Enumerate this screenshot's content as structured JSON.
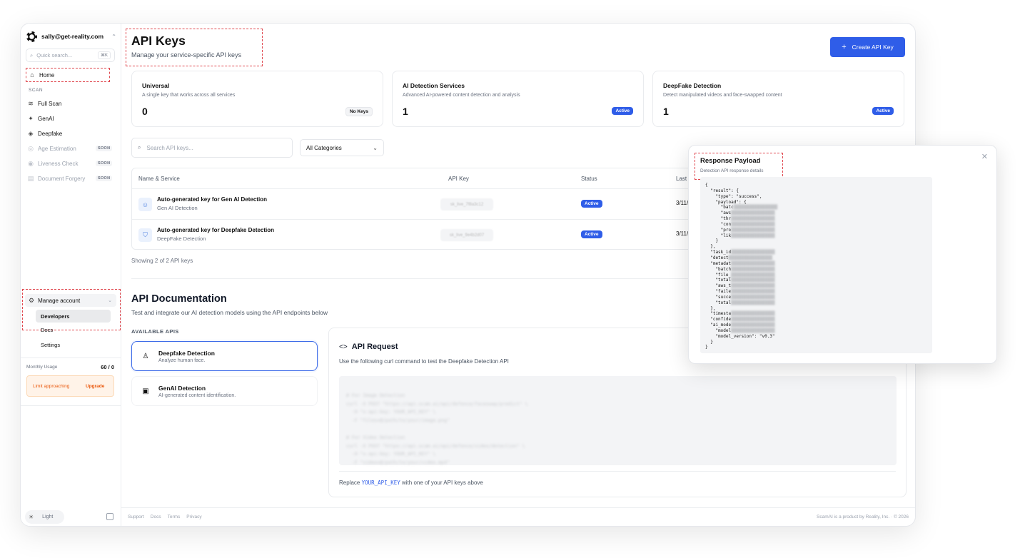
{
  "sidebar": {
    "account_email": "sally@get-reality.com",
    "search_placeholder": "Quick search...",
    "search_shortcut": "⌘K",
    "home_label": "Home",
    "section_scan": "SCAN",
    "items": [
      {
        "label": "Full Scan",
        "icon": "layers-icon"
      },
      {
        "label": "GenAI",
        "icon": "sparkles-icon"
      },
      {
        "label": "Deepfake",
        "icon": "tag-icon"
      },
      {
        "label": "Age Estimation",
        "icon": "user-circle-icon",
        "badge": "SOON"
      },
      {
        "label": "Liveness Check",
        "icon": "eye-icon",
        "badge": "SOON"
      },
      {
        "label": "Document Forgery",
        "icon": "document-icon",
        "badge": "SOON"
      }
    ],
    "manage_account": "Manage account",
    "sub_items": [
      "Developers",
      "Docs",
      "Settings"
    ],
    "usage_label": "Monthly Usage",
    "usage_value": "60 / 0",
    "limit_text": "Limit approaching",
    "upgrade_label": "Upgrade",
    "theme_label": "Light"
  },
  "header": {
    "title": "API Keys",
    "subtitle": "Manage your service-specific API keys",
    "create_button": "Create API Key"
  },
  "cards": [
    {
      "title": "Universal",
      "subtitle": "A single key that works across all services",
      "count": "0",
      "badge": "No Keys"
    },
    {
      "title": "AI Detection Services",
      "subtitle": "Advanced AI-powered content detection and analysis",
      "count": "1",
      "badge": "Active"
    },
    {
      "title": "DeepFake Detection",
      "subtitle": "Detect manipulated videos and face-swapped content",
      "count": "1",
      "badge": "Active"
    }
  ],
  "filters": {
    "search_placeholder": "Search API keys...",
    "category": "All Categories"
  },
  "table": {
    "headers": [
      "Name & Service",
      "API Key",
      "Status",
      "Last"
    ],
    "rows": [
      {
        "name": "Auto-generated key for Gen AI Detection",
        "service": "Gen AI Detection",
        "key": "sk_live_7f8a3c12",
        "status": "Active",
        "date": "3/11/2"
      },
      {
        "name": "Auto-generated key for Deepfake Detection",
        "service": "DeepFake Detection",
        "key": "sk_live_9e4b2d07",
        "status": "Active",
        "date": "3/11/2"
      }
    ],
    "showing": "Showing 2 of 2 API keys"
  },
  "docs": {
    "title": "API Documentation",
    "subtitle": "Test and integrate our AI detection models using the API endpoints below",
    "available_label": "AVAILABLE APIS",
    "apis": [
      {
        "title": "Deepfake Detection",
        "subtitle": "Analyze human face."
      },
      {
        "title": "GenAI Detection",
        "subtitle": "AI-generated content identification."
      }
    ],
    "request_title": "API Request",
    "request_desc": "Use the following curl command to test the Deepfake Detection API",
    "code_lines": [
      "# For Image Detection",
      "curl -X POST \"https://api.scam.ai/api/defence/faceswap/predict\" \\",
      "  -H \"x-api-key: YOUR_API_KEY\" \\",
      "  -F \"files=@/path/to/your/image.png\"",
      "",
      "# For Video Detection",
      "curl -X POST \"https://api.scam.ai/api/defence/video/detection\" \\",
      "  -H \"x-api-key: YOUR_API_KEY\" \\",
      "  -F \"video=@/path/to/your/video.mp4\""
    ],
    "replace_prefix": "Replace",
    "replace_key": "YOUR_API_KEY",
    "replace_suffix": "with one of your API keys above"
  },
  "footer": {
    "links": [
      "Support",
      "Docs",
      "Terms",
      "Privacy"
    ],
    "copyright": "ScamAI is a product by Reality, Inc. · © 2026"
  },
  "modal": {
    "title": "Response Payload",
    "subtitle": "Detection API response details",
    "payload_lines": [
      "{",
      "  \"result\": {",
      "    \"type\": \"success\",",
      "    \"payload\": {",
      "      \"batc",
      "      \"aws",
      "      \"thr",
      "      \"con",
      "      \"pro",
      "      \"lik",
      "    }",
      "  },",
      "  \"task_id",
      "  \"detect",
      "  \"metadat",
      "    \"batch",
      "    \"file_",
      "    \"total",
      "    \"aws_t",
      "    \"faile",
      "    \"succe",
      "    \"total",
      "  },",
      "  \"timesta",
      "  \"confide",
      "  \"ai_mode",
      "    \"model",
      "    \"model_version\": \"v0.3\"",
      "  }",
      "}"
    ]
  }
}
